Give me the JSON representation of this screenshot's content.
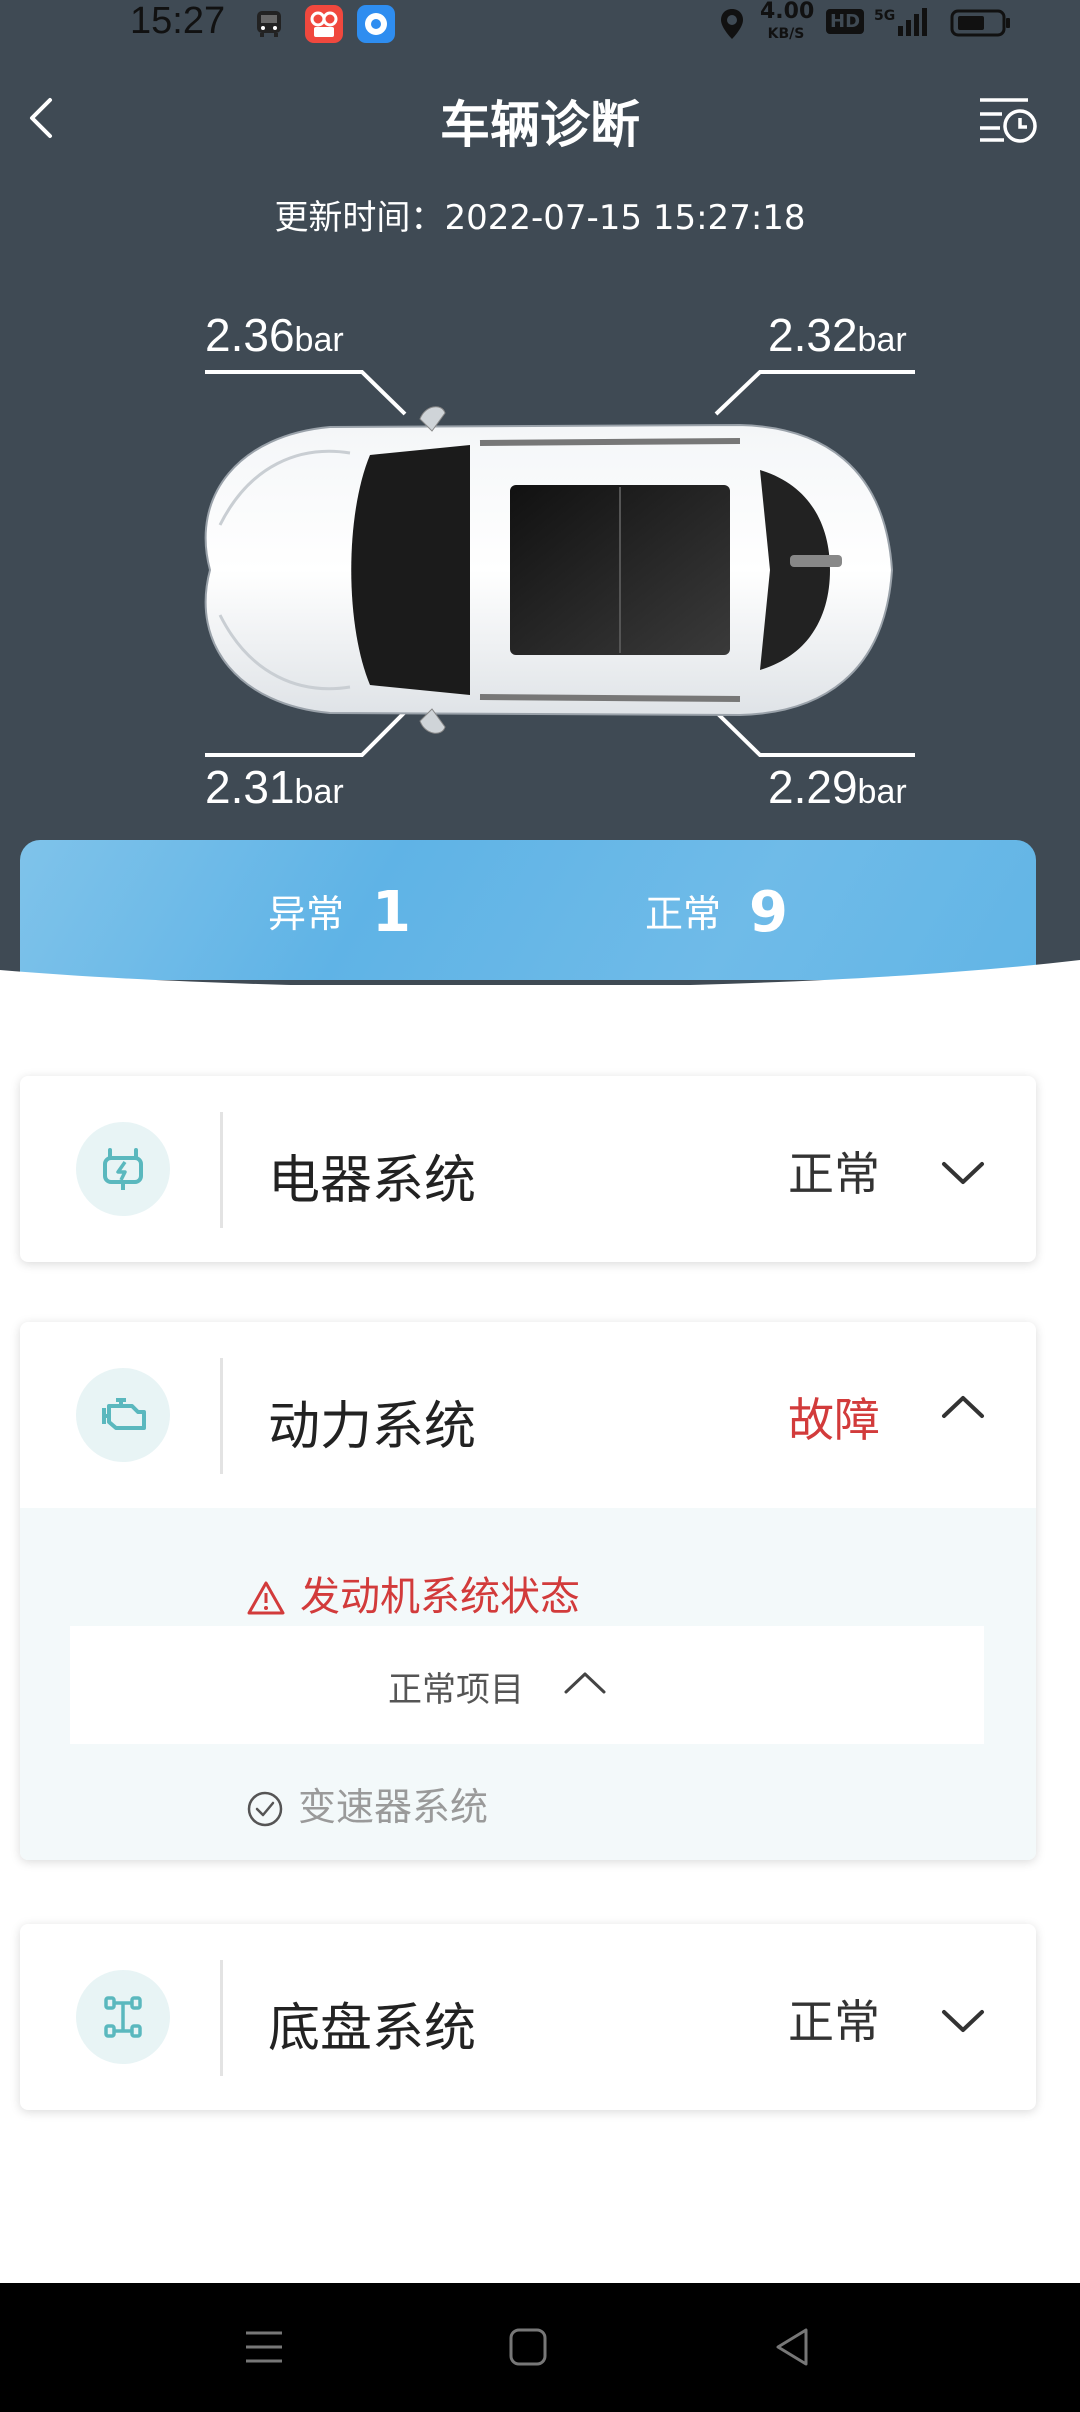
{
  "status_bar": {
    "time": "15:27",
    "net_speed_value": "4.00",
    "net_speed_unit": "KB/S",
    "hd_label": "HD",
    "network_label": "5G"
  },
  "nav": {
    "title": "车辆诊断"
  },
  "update": {
    "label": "更新时间：",
    "time": "2022-07-15 15:27:18"
  },
  "tires": {
    "front_left": {
      "value": "2.36",
      "unit": "bar"
    },
    "front_right": {
      "value": "2.32",
      "unit": "bar"
    },
    "rear_left": {
      "value": "2.31",
      "unit": "bar"
    },
    "rear_right": {
      "value": "2.29",
      "unit": "bar"
    }
  },
  "summary": {
    "abnormal_label": "异常",
    "abnormal_count": "1",
    "normal_label": "正常",
    "normal_count": "9"
  },
  "systems": [
    {
      "name": "电器系统",
      "status": "正常",
      "icon": "battery-plug-icon"
    },
    {
      "name": "动力系统",
      "status": "故障",
      "icon": "engine-icon",
      "fault_item": "发动机系统状态",
      "normal_items_label": "正常项目",
      "normal_items": [
        "变速器系统"
      ]
    },
    {
      "name": "底盘系统",
      "status": "正常",
      "icon": "chassis-icon"
    }
  ],
  "colors": {
    "header_bg": "#3f4a54",
    "fault": "#d23b3b",
    "accent_blue": "#62b5e6"
  }
}
